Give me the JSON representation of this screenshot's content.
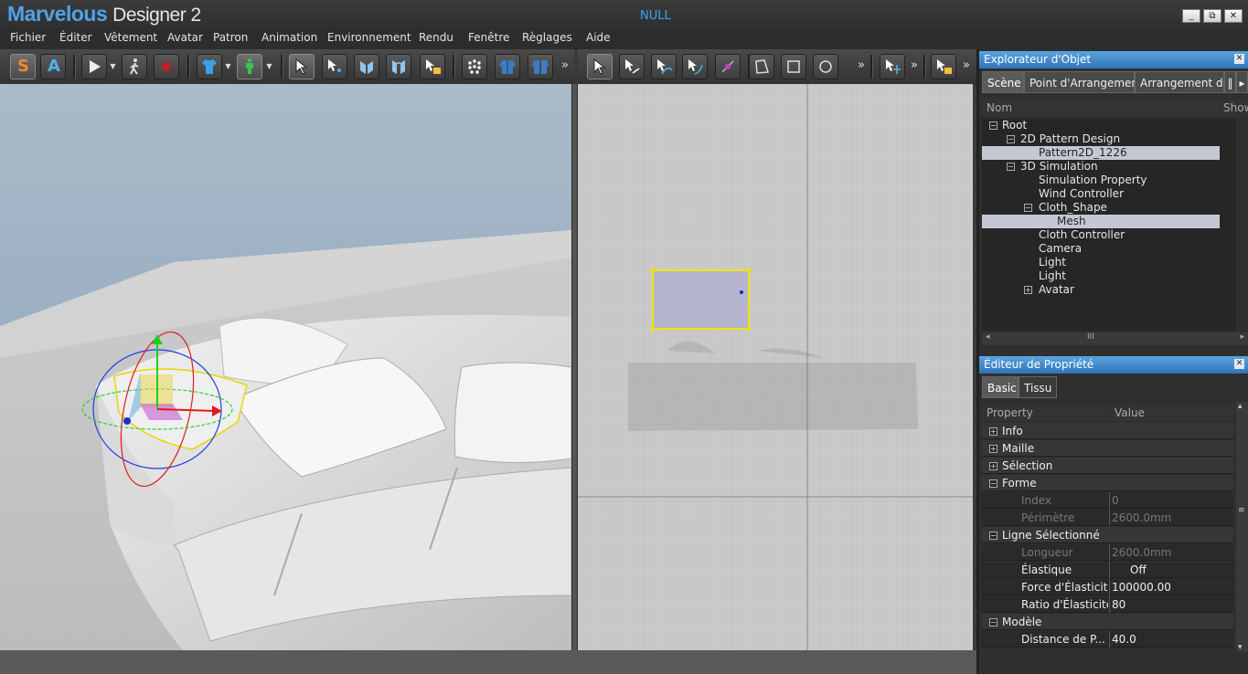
{
  "app": {
    "logo_main": "Marvelous",
    "logo_sub": "Designer 2",
    "document_title": "NULL"
  },
  "window_buttons": {
    "minimize": "_",
    "restore": "⧉",
    "close": "✕"
  },
  "menu": [
    "Fichier",
    "Éditer",
    "Vêtement",
    "Avatar",
    "Patron",
    "Animation",
    "Environnement",
    "Rendu",
    "Fenêtre",
    "Règlages",
    "Aide"
  ],
  "toolbar": {
    "simulate_label": "S",
    "animate_label": "A",
    "more": "»"
  },
  "object_explorer": {
    "title": "Explorateur d'Objet",
    "tabs": [
      "Scène",
      "Point d'Arrangement",
      "Arrangement de"
    ],
    "columns": [
      "Nom",
      "Show"
    ],
    "tree": [
      {
        "label": "Root",
        "expander": "−"
      },
      {
        "label": "2D Pattern Design",
        "expander": "−"
      },
      {
        "label": "Pattern2D_1226",
        "expander": ""
      },
      {
        "label": "3D Simulation",
        "expander": "−"
      },
      {
        "label": "Simulation Property",
        "expander": ""
      },
      {
        "label": "Wind Controller",
        "expander": ""
      },
      {
        "label": "Cloth_Shape",
        "expander": "−"
      },
      {
        "label": "Mesh",
        "expander": ""
      },
      {
        "label": "Cloth Controller",
        "expander": ""
      },
      {
        "label": "Camera",
        "expander": ""
      },
      {
        "label": "Light",
        "expander": ""
      },
      {
        "label": "Light",
        "expander": ""
      },
      {
        "label": "Avatar",
        "expander": "+"
      }
    ],
    "scroll_grip": "III"
  },
  "property_editor": {
    "title": "Éditeur de Propriété",
    "tabs": [
      "Basic",
      "Tissu"
    ],
    "columns": [
      "Property",
      "Value"
    ],
    "rows": [
      {
        "kind": "group",
        "label": "Info",
        "expander": "+"
      },
      {
        "kind": "group",
        "label": "Maille",
        "expander": "+"
      },
      {
        "kind": "group",
        "label": "Sélection",
        "expander": "+"
      },
      {
        "kind": "group",
        "label": "Forme",
        "expander": "−"
      },
      {
        "kind": "item",
        "label": "Index",
        "value": "0",
        "disabled": true
      },
      {
        "kind": "item",
        "label": "Périmètre",
        "value": "2600.0mm",
        "disabled": true
      },
      {
        "kind": "group",
        "label": "Ligne Sélectionné",
        "expander": "−"
      },
      {
        "kind": "item",
        "label": "Longueur",
        "value": "2600.0mm",
        "disabled": true
      },
      {
        "kind": "item",
        "label": "Élastique",
        "value": "Off",
        "disabled": false
      },
      {
        "kind": "item",
        "label": "Force d'Élasticité",
        "value": "100000.00",
        "disabled": false
      },
      {
        "kind": "item",
        "label": "Ratio d'Élasticité",
        "value": "80",
        "disabled": false
      },
      {
        "kind": "group",
        "label": "Modèle",
        "expander": "−"
      },
      {
        "kind": "item",
        "label": "Distance de P...",
        "value": "40.0",
        "disabled": false
      }
    ]
  },
  "colors": {
    "accent": "#3fa4f0",
    "panel_title": "#2f74b8",
    "selection": "#c5c8d4",
    "pattern_outline": "#f0e400"
  }
}
